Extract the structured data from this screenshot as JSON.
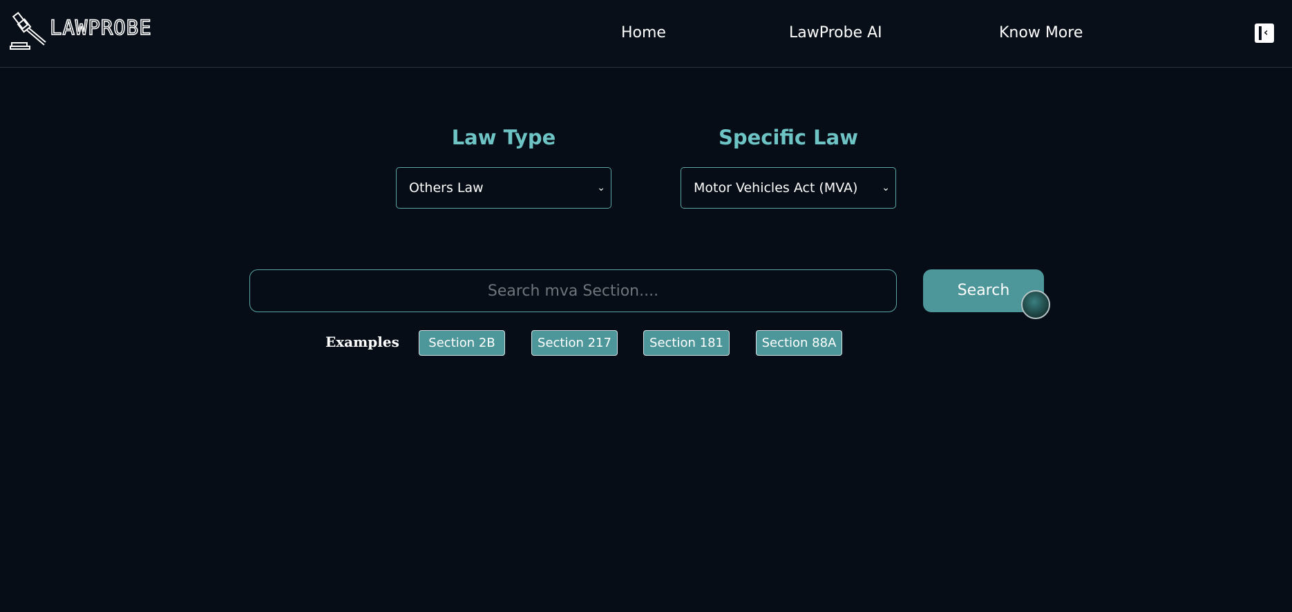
{
  "header": {
    "logo_text": "LAWPROBE",
    "logo_icon": "gavel-icon",
    "nav": [
      {
        "label": "Home"
      },
      {
        "label": "LawProbe AI"
      },
      {
        "label": "Know More"
      }
    ],
    "collapse_icon": "sidebar-collapse-icon"
  },
  "filters": {
    "law_type": {
      "label": "Law Type",
      "selected": "Others Law"
    },
    "specific_law": {
      "label": "Specific Law",
      "selected": "Motor Vehicles Act (MVA)"
    }
  },
  "search": {
    "placeholder": "Search mva Section....",
    "value": "",
    "button_label": "Search"
  },
  "examples": {
    "label": "Examples",
    "items": [
      "Section 2B",
      "Section 217",
      "Section 181",
      "Section 88A"
    ]
  },
  "colors": {
    "accent": "#6ec4c5",
    "button": "#4d9699",
    "background": "#060d16"
  }
}
